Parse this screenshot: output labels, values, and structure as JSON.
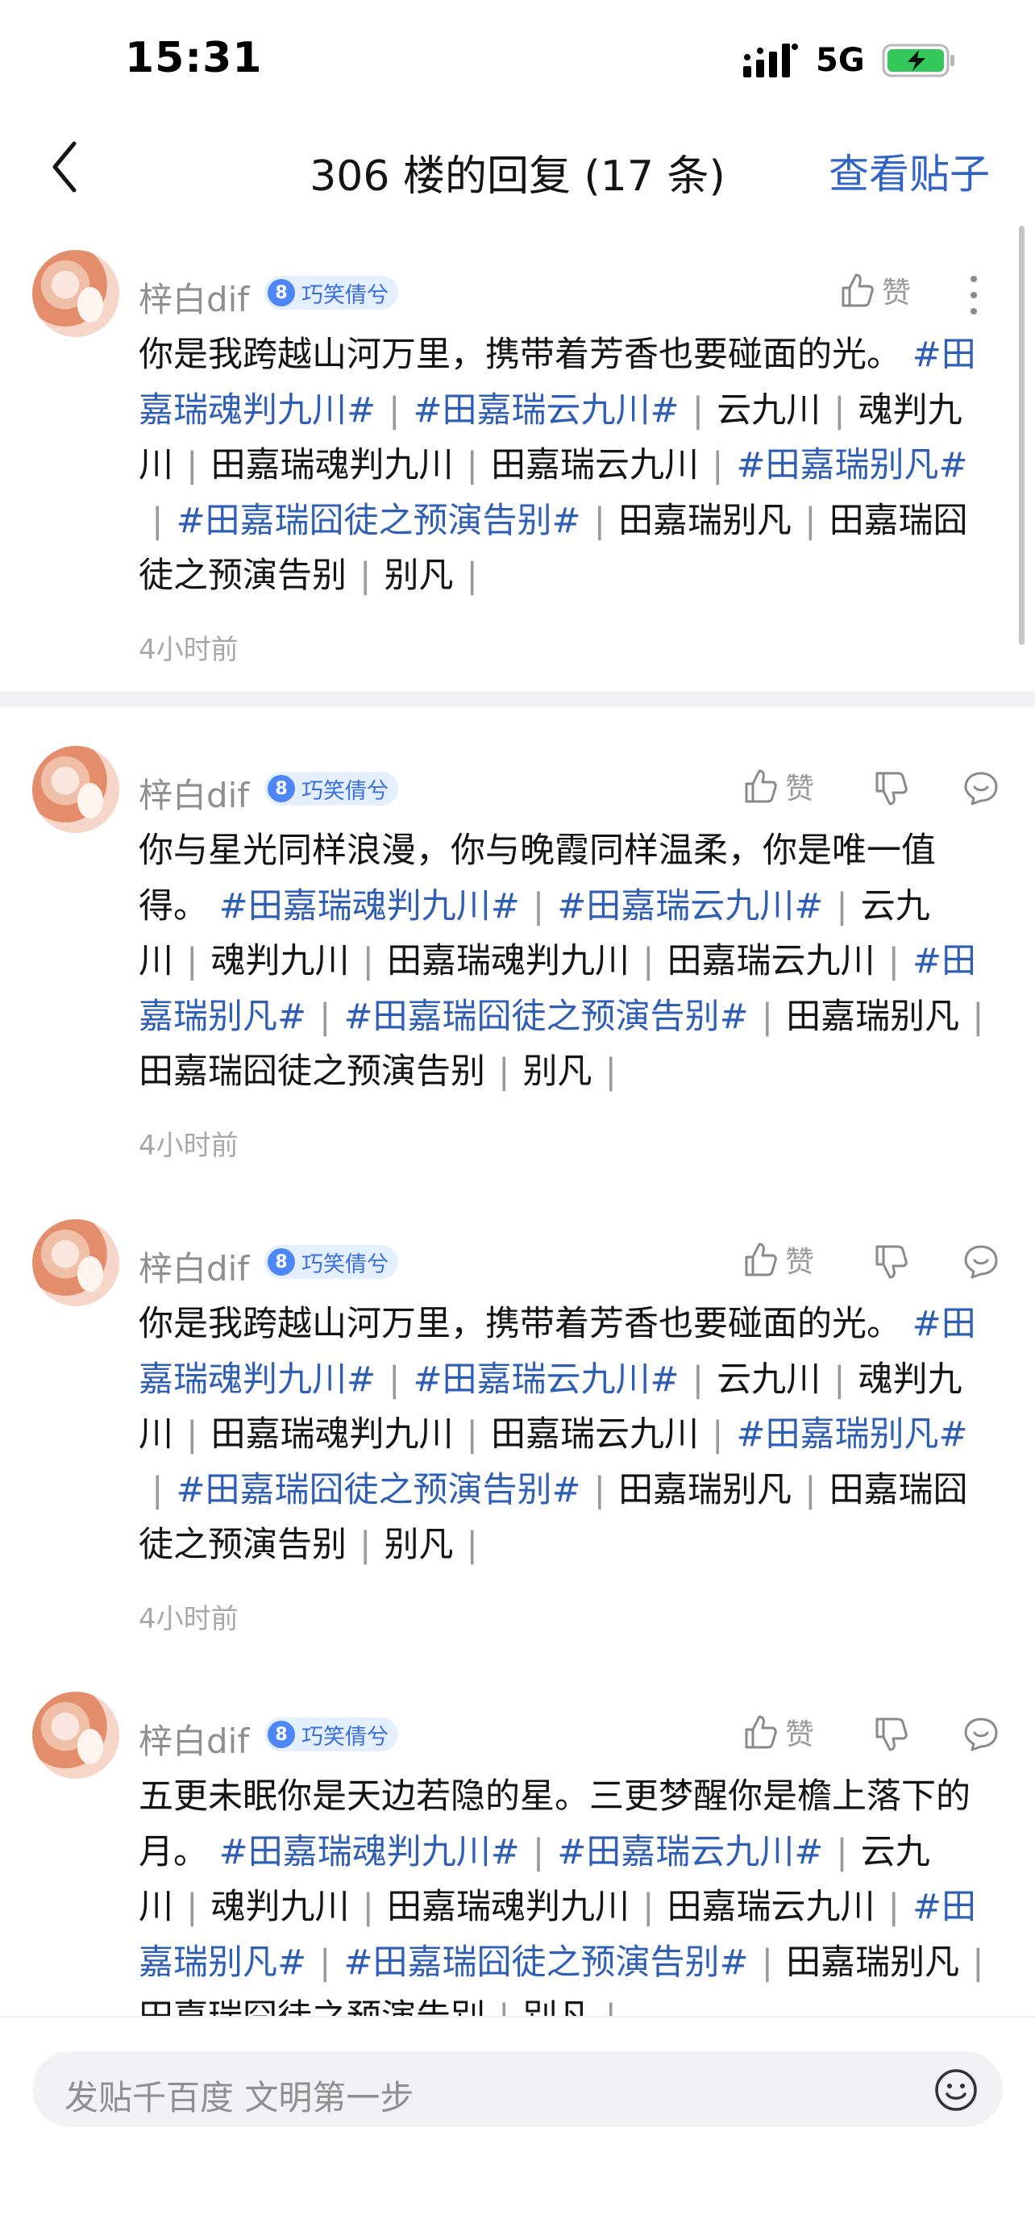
{
  "status_bar": {
    "time": "15:31",
    "network": "5G"
  },
  "nav": {
    "title": "306 楼的回复 (17 条)",
    "view_post": "查看贴子"
  },
  "replies": [
    {
      "user": "梓白dif",
      "level": "8",
      "badge": "巧笑倩兮",
      "like_label": "赞",
      "text": "你是我跨越山河万里，携带着芳香也要碰面的光。",
      "topics": [
        "#田嘉瑞魂判九川#",
        "#田嘉瑞云九川#"
      ],
      "mid": [
        "云九川",
        "魂判九川",
        "田嘉瑞魂判九川",
        "田嘉瑞云九川"
      ],
      "topics2": [
        "#田嘉瑞别凡#",
        "#田嘉瑞囧徒之预演告别#"
      ],
      "tail": [
        "田嘉瑞别凡",
        "田嘉瑞囧徒之预演告别",
        "别凡"
      ],
      "time": "4小时前"
    },
    {
      "user": "梓白dif",
      "level": "8",
      "badge": "巧笑倩兮",
      "like_label": "赞",
      "text": "你与星光同样浪漫，你与晚霞同样温柔，你是唯一值得。",
      "topics": [
        "#田嘉瑞魂判九川#",
        "#田嘉瑞云九川#"
      ],
      "mid": [
        "云九川",
        "魂判九川",
        "田嘉瑞魂判九川",
        "田嘉瑞云九川"
      ],
      "topics2": [
        "#田嘉瑞别凡#",
        "#田嘉瑞囧徒之预演告别#"
      ],
      "tail": [
        "田嘉瑞别凡",
        "田嘉瑞囧徒之预演告别",
        "别凡"
      ],
      "time": "4小时前"
    },
    {
      "user": "梓白dif",
      "level": "8",
      "badge": "巧笑倩兮",
      "like_label": "赞",
      "text": "你是我跨越山河万里，携带着芳香也要碰面的光。",
      "topics": [
        "#田嘉瑞魂判九川#",
        "#田嘉瑞云九川#"
      ],
      "mid": [
        "云九川",
        "魂判九川",
        "田嘉瑞魂判九川",
        "田嘉瑞云九川"
      ],
      "topics2": [
        "#田嘉瑞别凡#",
        "#田嘉瑞囧徒之预演告别#"
      ],
      "tail": [
        "田嘉瑞别凡",
        "田嘉瑞囧徒之预演告别",
        "别凡"
      ],
      "time": "4小时前"
    },
    {
      "user": "梓白dif",
      "level": "8",
      "badge": "巧笑倩兮",
      "like_label": "赞",
      "text": "五更未眠你是天边若隐的星。三更梦醒你是檐上落下的月。",
      "topics": [
        "#田嘉瑞魂判九川#",
        "#田嘉瑞云九川#"
      ],
      "mid": [
        "云九川",
        "魂判九川",
        "田嘉瑞魂判九川",
        "田嘉瑞云九川"
      ],
      "topics2": [
        "#田嘉瑞别凡#",
        "#田嘉瑞囧徒之预演告别#"
      ],
      "tail": [
        "田嘉瑞别凡",
        "田嘉瑞囧徒之预演告别",
        "别凡"
      ],
      "time": ""
    }
  ],
  "input": {
    "placeholder": "发贴千百度 文明第一步"
  }
}
